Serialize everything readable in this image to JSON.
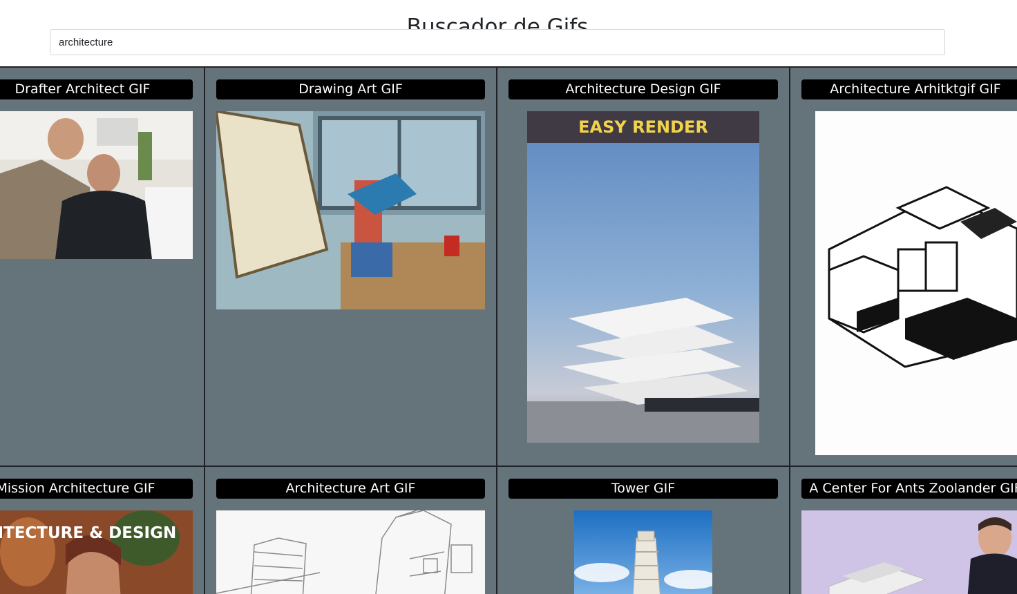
{
  "header": {
    "title": "Buscador de Gifs"
  },
  "search": {
    "value": "architecture"
  },
  "gifs": [
    {
      "title": "Drafter Architect GIF"
    },
    {
      "title": "Drawing Art GIF"
    },
    {
      "title": "Architecture Design GIF",
      "overlay_text": "EASY RENDER"
    },
    {
      "title": "Architecture Arhitktgif GIF"
    },
    {
      "title": "Mission Architecture GIF",
      "overlay_text": "ARCHITECTURE & DESIGN"
    },
    {
      "title": "Architecture Art GIF"
    },
    {
      "title": "Tower GIF"
    },
    {
      "title": "A Center For Ants Zoolander GIF"
    }
  ]
}
